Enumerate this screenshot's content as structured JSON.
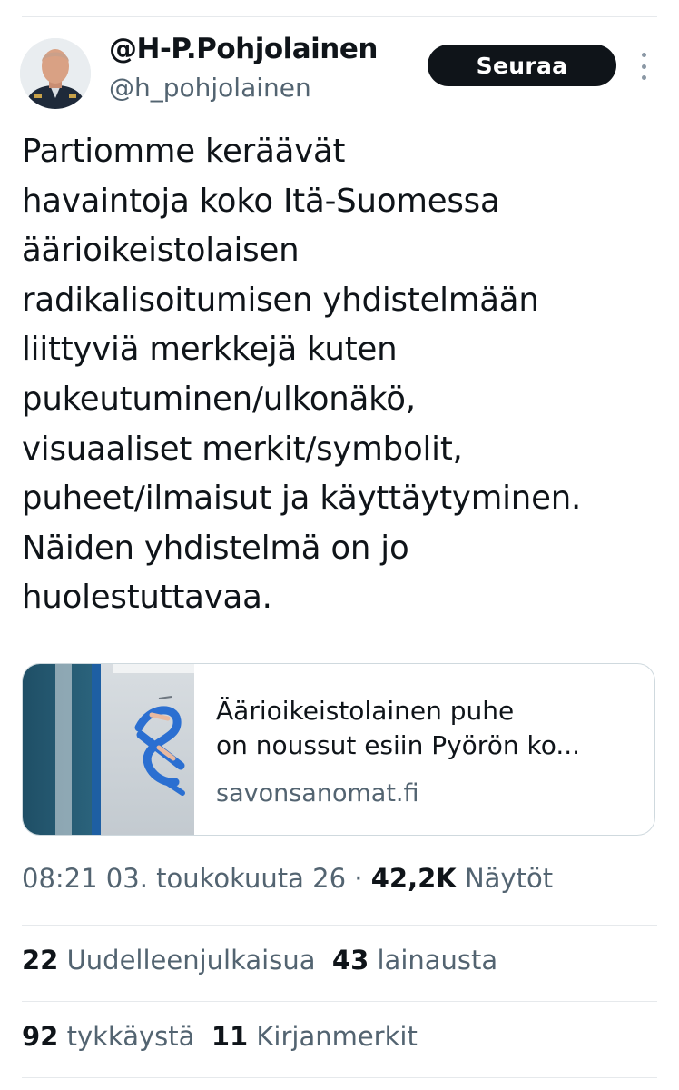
{
  "author": {
    "display_name": "@H-P.Pohjolainen",
    "handle": "@h_pohjolainen",
    "follow_label": "Seuraa"
  },
  "tweet": {
    "text_lines": [
      "Partiomme keräävät",
      "havaintoja koko Itä-Suomessa",
      "äärioikeistolaisen",
      "radikalisoitumisen yhdistelmään",
      "liittyviä merkkejä kuten",
      "pukeutuminen/ulkonäkö,",
      "visuaaliset merkit/symbolit,",
      "puheet/ilmaisut ja käyttäytyminen.",
      "Näiden yhdistelmä on jo",
      "huolestuttavaa."
    ]
  },
  "link_card": {
    "title_line1": "Äärioikeistolainen puhe",
    "title_line2": "on noussut esiin Pyörön ko...",
    "domain": "savonsanomat.fi"
  },
  "meta": {
    "time": "08:21",
    "date": "03. toukokuuta 26",
    "separator": "·",
    "views_count": "42,2K",
    "views_label": "Näytöt"
  },
  "stats": {
    "reposts_count": "22",
    "reposts_label": "Uudelleenjulkaisua",
    "quotes_count": "43",
    "quotes_label": "lainausta",
    "likes_count": "92",
    "likes_label": "tykkäystä",
    "bookmarks_count": "11",
    "bookmarks_label": "Kirjanmerkit"
  },
  "icons": {
    "more": "more-vertical-icon"
  },
  "colors": {
    "text_primary": "#0f1419",
    "text_secondary": "#536471",
    "follow_button_bg": "#0f1419",
    "border": "#cfd9de"
  }
}
